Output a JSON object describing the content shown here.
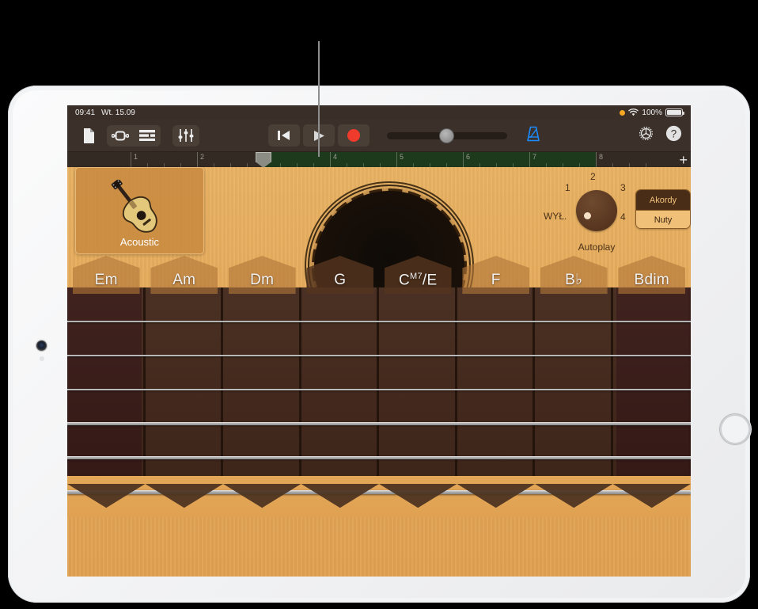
{
  "status_bar": {
    "time": "09:41",
    "date": "Wt. 15.09",
    "battery_percent": "100%",
    "recording_dot": "orange-dot-icon",
    "wifi_icon": "wifi-icon",
    "battery_icon": "battery-icon"
  },
  "toolbar": {
    "left_icons": [
      {
        "name": "document-icon",
        "label": "Dokument"
      },
      {
        "name": "loop-browser-icon",
        "label": "Pętle"
      },
      {
        "name": "track-list-icon",
        "label": "Lista ścieżek"
      },
      {
        "name": "mixer-sliders-icon",
        "label": "Miks"
      }
    ],
    "transport": {
      "rewind": "rewind-icon",
      "play": "play-icon",
      "record": "record-icon",
      "record_color": "#ef3b2c",
      "master_volume": 43
    },
    "metronome": {
      "name": "metronome-icon",
      "color": "#1a8cff",
      "active": true
    },
    "right_icons": [
      {
        "name": "gear-icon",
        "label": "Ustawienia"
      },
      {
        "name": "help-icon",
        "label": "Pomoc"
      }
    ]
  },
  "ruler": {
    "bars": [
      "1",
      "2",
      "3",
      "4",
      "5",
      "6",
      "7",
      "8"
    ],
    "playhead_bar": "3",
    "region_start_bar": 3,
    "region_end_bar": 8,
    "add_button": "+",
    "green_color": "#1d3a1c"
  },
  "instrument": {
    "label": "Acoustic",
    "icon": "acoustic-guitar-icon"
  },
  "autoplay": {
    "caption": "Autoplay",
    "off_label": "WYŁ.",
    "positions": [
      "1",
      "2",
      "3",
      "4"
    ],
    "selected": "WYŁ."
  },
  "mode_toggle": {
    "chords_label": "Akordy",
    "notes_label": "Nuty",
    "selected": "Akordy"
  },
  "chords": [
    {
      "root": "Em",
      "sup": ""
    },
    {
      "root": "Am",
      "sup": ""
    },
    {
      "root": "Dm",
      "sup": ""
    },
    {
      "root": "G",
      "sup": ""
    },
    {
      "root": "C",
      "sup": "M7",
      "tail": "/E"
    },
    {
      "root": "F",
      "sup": ""
    },
    {
      "root": "B♭",
      "sup": ""
    },
    {
      "root": "Bdim",
      "sup": ""
    }
  ],
  "fretboard": {
    "string_count": 6,
    "column_count": 8
  },
  "colors": {
    "body_wood": "#e5a95a",
    "fretboard": "#43291d",
    "chord_tab": "rgba(176,118,56,.62)",
    "accent_blue": "#1a8cff"
  }
}
